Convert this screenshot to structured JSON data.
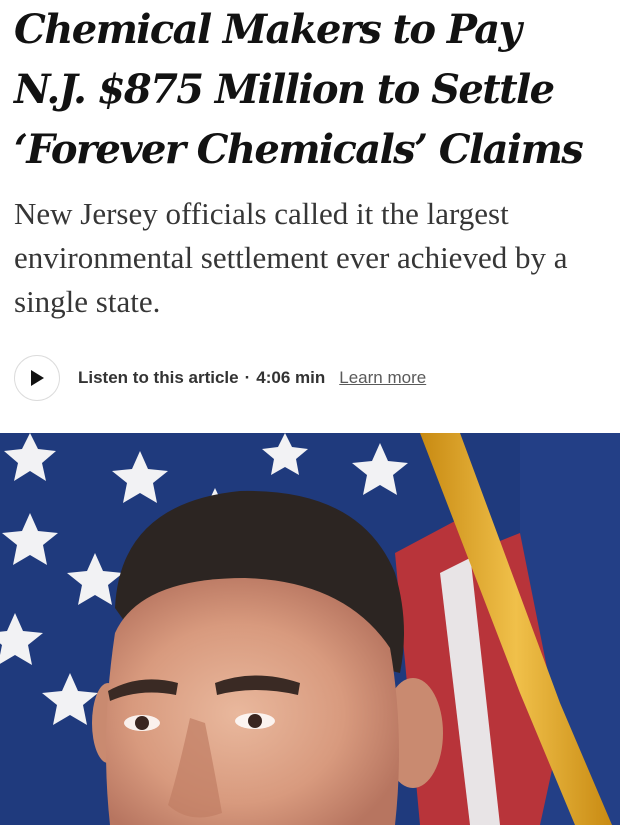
{
  "article": {
    "headline_lines": [
      "Chemical Makers to Pay",
      "N.J. $875 Million to Settle",
      "‘Forever Chemicals’ Claims"
    ],
    "summary": "New Jersey officials called it the largest environmental settlement ever achieved by a single state.",
    "audio": {
      "label": "Listen to this article",
      "separator": "·",
      "duration": "4:06 min",
      "learn_more": "Learn more"
    },
    "photo": {
      "subject": "man-at-press-conference",
      "background": "american-flag"
    }
  },
  "icons": {
    "play": "play-icon"
  },
  "colors": {
    "text": "#121212",
    "summary_text": "#363636",
    "flag_blue": "#1f3a7d",
    "flag_red": "#b8343a",
    "fringe_gold": "#d9a21e"
  }
}
